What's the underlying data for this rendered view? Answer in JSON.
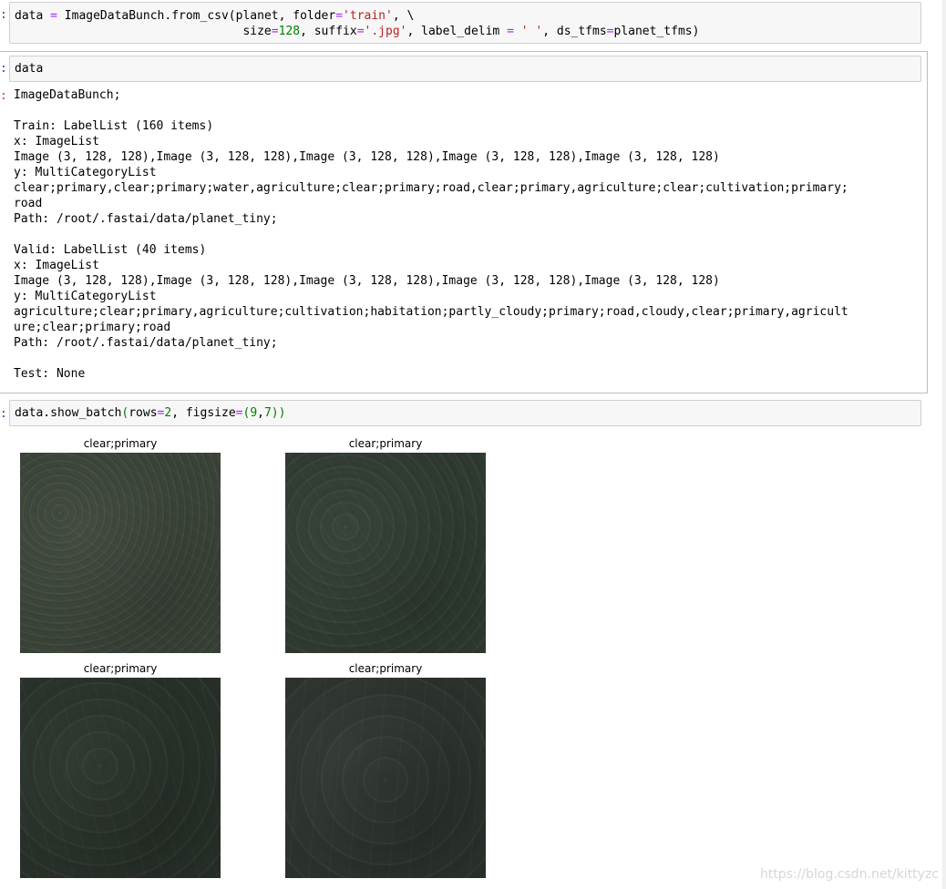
{
  "cells": [
    {
      "prompt": ":",
      "code_lines": [
        [
          [
            "",
            "data "
          ],
          [
            "op",
            "="
          ],
          [
            "",
            " ImageDataBunch.from_csv(planet, folder"
          ],
          [
            "op",
            "="
          ],
          [
            "str",
            "'train'"
          ],
          [
            "",
            ", \\"
          ]
        ],
        [
          [
            "",
            "                                size"
          ],
          [
            "op",
            "="
          ],
          [
            "num",
            "128"
          ],
          [
            "",
            ", suffix"
          ],
          [
            "op",
            "="
          ],
          [
            "str",
            "'.jpg'"
          ],
          [
            "",
            ", label_delim "
          ],
          [
            "op",
            "="
          ],
          [
            "",
            " "
          ],
          [
            "str",
            "' '"
          ],
          [
            "",
            ", ds_tfms"
          ],
          [
            "op",
            "="
          ],
          [
            "",
            "planet_tfms)"
          ]
        ]
      ]
    },
    {
      "prompt": ":",
      "code_lines": [
        [
          [
            "",
            "data"
          ]
        ]
      ],
      "out_prompt": ":",
      "output_lines": [
        "ImageDataBunch;",
        "",
        "Train: LabelList (160 items)",
        "x: ImageList",
        "Image (3, 128, 128),Image (3, 128, 128),Image (3, 128, 128),Image (3, 128, 128),Image (3, 128, 128)",
        "y: MultiCategoryList",
        "clear;primary,clear;primary;water,agriculture;clear;primary;road,clear;primary,agriculture;clear;cultivation;primary;",
        "road",
        "Path: /root/.fastai/data/planet_tiny;",
        "",
        "Valid: LabelList (40 items)",
        "x: ImageList",
        "Image (3, 128, 128),Image (3, 128, 128),Image (3, 128, 128),Image (3, 128, 128),Image (3, 128, 128)",
        "y: MultiCategoryList",
        "agriculture;clear;primary,agriculture;cultivation;habitation;partly_cloudy;primary;road,cloudy,clear;primary,agricult",
        "ure;clear;primary;road",
        "Path: /root/.fastai/data/planet_tiny;",
        "",
        "Test: None"
      ]
    },
    {
      "prompt": ":",
      "code_lines": [
        [
          [
            "",
            "data.show_batch"
          ],
          [
            "paren",
            "("
          ],
          [
            "",
            "rows"
          ],
          [
            "op",
            "="
          ],
          [
            "num",
            "2"
          ],
          [
            "",
            ", figsize"
          ],
          [
            "op",
            "="
          ],
          [
            "paren",
            "("
          ],
          [
            "num",
            "9"
          ],
          [
            "",
            ","
          ],
          [
            "num",
            "7"
          ],
          [
            "paren",
            "))"
          ]
        ]
      ]
    }
  ],
  "batch": [
    {
      "title": "clear;primary",
      "tone": "#3b4439"
    },
    {
      "title": "clear;primary",
      "tone": "#2f3c31"
    },
    {
      "title": "clear;primary",
      "tone": "#283229"
    },
    {
      "title": "clear;primary",
      "tone": "#2c342d"
    }
  ],
  "watermark": "https://blog.csdn.net/kittyzc"
}
